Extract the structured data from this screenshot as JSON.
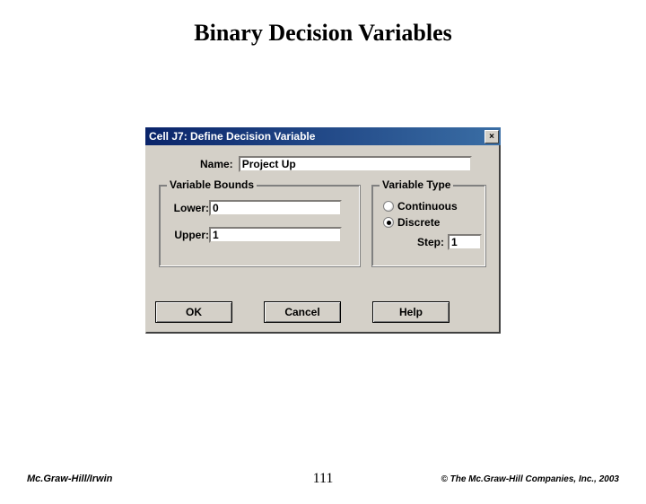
{
  "slide": {
    "title": "Binary Decision Variables"
  },
  "dialog": {
    "title": "Cell J7: Define Decision Variable",
    "close": "×",
    "name_label": "Name:",
    "name_value": "Project Up",
    "bounds": {
      "legend": "Variable Bounds",
      "lower_label": "Lower:",
      "lower_value": "0",
      "upper_label": "Upper:",
      "upper_value": "1"
    },
    "type": {
      "legend": "Variable Type",
      "continuous_label": "Continuous",
      "discrete_label": "Discrete",
      "selected": "discrete",
      "step_label": "Step:",
      "step_value": "1"
    },
    "buttons": {
      "ok": "OK",
      "cancel": "Cancel",
      "help": "Help"
    }
  },
  "footer": {
    "left": "Mc.Graw-Hill/Irwin",
    "center": "111",
    "right": "© The Mc.Graw-Hill Companies, Inc., 2003"
  }
}
